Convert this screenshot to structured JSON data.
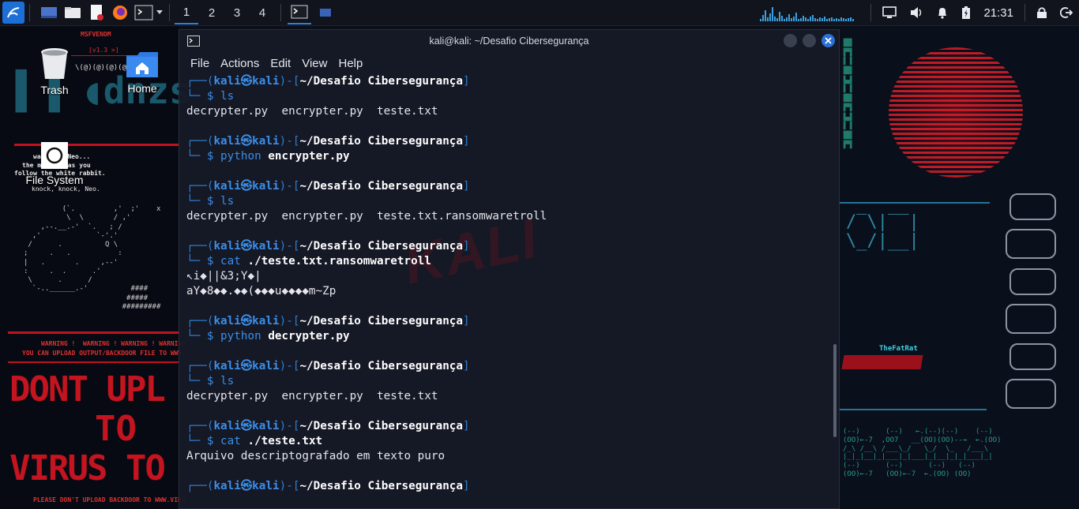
{
  "panel": {
    "workspaces": [
      "1",
      "2",
      "3",
      "4"
    ],
    "clock": "21:31",
    "accent": "#2d7fd8"
  },
  "desktop": {
    "icons": [
      {
        "label": "Trash",
        "icon": "trash-icon"
      },
      {
        "label": "Home",
        "icon": "home-folder-icon"
      },
      {
        "label": "File System",
        "icon": "drive-icon"
      }
    ]
  },
  "wallpaper": {
    "left_texts": {
      "msfvenom": "MSFVENOM",
      "version": "[v1.3 >]",
      "wake_up_1": "wake up, Neo...",
      "wake_up_2": "the matrix has you",
      "wake_up_3": "follow the white rabbit.",
      "knock": "knock, knock, Neo.",
      "warning_1": "WARNING !  WARNING ! WARNING ! WARNING",
      "warning_2": "YOU CAN UPLOAD OUTPUT/BACKDOOR FILE TO WWW.",
      "big_1": "DONT UPL",
      "big_2": "TO",
      "big_3": "VIRUS TO",
      "bottom": "PLEASE DON'T UPLOAD BACKDOOR TO WWW.VIRU"
    },
    "right_texts": {
      "fatrat": "TheFatRat"
    }
  },
  "terminal": {
    "title": "kali@kali: ~/Desafio Cibersegurança",
    "menu": [
      "File",
      "Actions",
      "Edit",
      "View",
      "Help"
    ],
    "prompt": {
      "open": "┌──(",
      "user": "kali",
      "at": "㉿",
      "host": "kali",
      "mid": ")-[",
      "path": "~/Desafio Cibersegurança",
      "close": "]",
      "corner": "└─",
      "dollar": "$"
    },
    "blocks": [
      {
        "cmd": "ls",
        "arg": "",
        "output": [
          "decrypter.py  encrypter.py  teste.txt"
        ]
      },
      {
        "cmd": "python",
        "arg": "encrypter.py",
        "output": []
      },
      {
        "cmd": "ls",
        "arg": "",
        "output": [
          "decrypter.py  encrypter.py  teste.txt.ransomwaretroll"
        ]
      },
      {
        "cmd": "cat",
        "arg": "./teste.txt.ransomwaretroll",
        "output": [
          "↖i◆||&3;Y◆|",
          "aY◆8◆◆.◆◆(◆◆◆u◆◆◆◆m~Zp"
        ]
      },
      {
        "cmd": "python",
        "arg": "decrypter.py",
        "output": []
      },
      {
        "cmd": "ls",
        "arg": "",
        "output": [
          "decrypter.py  encrypter.py  teste.txt"
        ]
      },
      {
        "cmd": "cat",
        "arg": "./teste.txt",
        "output": [
          "Arquivo descriptografado em texto puro"
        ]
      }
    ]
  }
}
